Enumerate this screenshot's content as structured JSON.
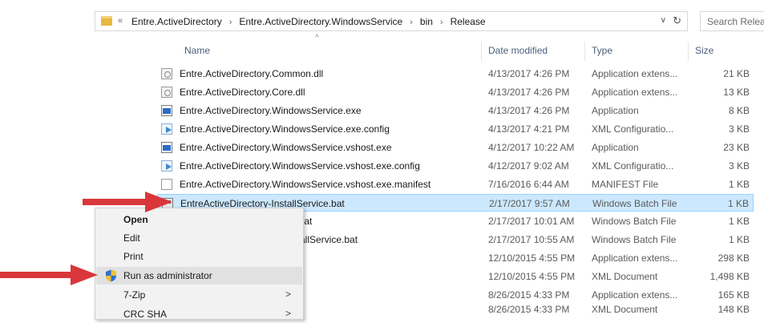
{
  "address_bar": {
    "overflow_glyph": "«",
    "crumbs": [
      "Entre.ActiveDirectory",
      "Entre.ActiveDirectory.WindowsService",
      "bin",
      "Release"
    ],
    "separator": "›",
    "dropdown_glyph": "∨",
    "refresh_glyph": "↻"
  },
  "search": {
    "placeholder": "Search Release"
  },
  "columns": {
    "name": "Name",
    "date": "Date modified",
    "type": "Type",
    "size": "Size",
    "sort_glyph": "^"
  },
  "files": [
    {
      "name": "Entre.ActiveDirectory.Common.dll",
      "date": "4/13/2017 4:26 PM",
      "type": "Application extens...",
      "size": "21 KB",
      "icon": "dll-file-icon"
    },
    {
      "name": "Entre.ActiveDirectory.Core.dll",
      "date": "4/13/2017 4:26 PM",
      "type": "Application extens...",
      "size": "13 KB",
      "icon": "dll-file-icon"
    },
    {
      "name": "Entre.ActiveDirectory.WindowsService.exe",
      "date": "4/13/2017 4:26 PM",
      "type": "Application",
      "size": "8 KB",
      "icon": "exe-file-icon"
    },
    {
      "name": "Entre.ActiveDirectory.WindowsService.exe.config",
      "date": "4/13/2017 4:21 PM",
      "type": "XML Configuratio...",
      "size": "3 KB",
      "icon": "config-file-icon"
    },
    {
      "name": "Entre.ActiveDirectory.WindowsService.vshost.exe",
      "date": "4/12/2017 10:22 AM",
      "type": "Application",
      "size": "23 KB",
      "icon": "exe-file-icon"
    },
    {
      "name": "Entre.ActiveDirectory.WindowsService.vshost.exe.config",
      "date": "4/12/2017 9:02 AM",
      "type": "XML Configuratio...",
      "size": "3 KB",
      "icon": "config-file-icon"
    },
    {
      "name": "Entre.ActiveDirectory.WindowsService.vshost.exe.manifest",
      "date": "7/16/2016 6:44 AM",
      "type": "MANIFEST File",
      "size": "1 KB",
      "icon": "manifest-file-icon"
    },
    {
      "name": "EntreActiveDirectory-InstallService.bat",
      "date": "2/17/2017 9:57 AM",
      "type": "Windows Batch File",
      "size": "1 KB",
      "icon": "bat-file-icon",
      "selected": true
    },
    {
      "name": "vice.bat",
      "date": "2/17/2017 10:01 AM",
      "type": "Windows Batch File",
      "size": "1 KB"
    },
    {
      "name": "allService.bat",
      "date": "2/17/2017 10:55 AM",
      "type": "Windows Batch File",
      "size": "1 KB"
    },
    {
      "name": "",
      "date": "12/10/2015 4:55 PM",
      "type": "Application extens...",
      "size": "298 KB"
    },
    {
      "name": "",
      "date": "12/10/2015 4:55 PM",
      "type": "XML Document",
      "size": "1,498 KB"
    },
    {
      "name": "",
      "date": "8/26/2015 4:33 PM",
      "type": "Application extens...",
      "size": "165 KB"
    },
    {
      "name": "",
      "date": "8/26/2015 4:33 PM",
      "type": "XML Document",
      "size": "148 KB"
    }
  ],
  "context_menu": {
    "items": [
      {
        "label": "Open",
        "bold": true
      },
      {
        "label": "Edit"
      },
      {
        "label": "Print"
      },
      {
        "label": "Run as administrator",
        "icon": "uac-shield-icon",
        "highlighted": true
      },
      {
        "label": "7-Zip",
        "submenu": true
      },
      {
        "label": "CRC SHA",
        "submenu": true
      }
    ],
    "submenu_glyph": ">"
  },
  "colors": {
    "selection": "#cce8ff",
    "selection_border": "#99d1ff",
    "arrow": "#d9373a",
    "header_text": "#4c607a"
  }
}
